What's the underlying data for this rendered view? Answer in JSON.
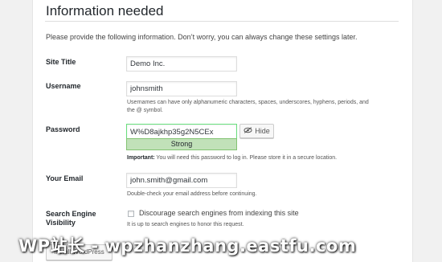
{
  "section": {
    "title": "Information needed",
    "intro": "Please provide the following information. Don’t worry, you can always change these settings later."
  },
  "site_title": {
    "label": "Site Title",
    "value": "Demo Inc."
  },
  "username": {
    "label": "Username",
    "value": "johnsmith",
    "hint_line1": "Usernames can have only alphanumeric characters, spaces, underscores, hyphens, periods, and",
    "hint_line2": "the @ symbol."
  },
  "password": {
    "label": "Password",
    "value": "W%D8ajkhp35g2N5CEx",
    "strength": "Strong",
    "hide_label": "Hide",
    "hide_icon": "eye-slash-icon",
    "important_prefix": "Important:",
    "important_text": " You will need this password to log in. Please store it in a secure location."
  },
  "email": {
    "label": "Your Email",
    "value": "john.smith@gmail.com",
    "hint": "Double-check your email address before continuing."
  },
  "search_engine": {
    "label_line1": "Search Engine",
    "label_line2": "Visibility",
    "checkbox_label": "Discourage search engines from indexing this site",
    "checked": false,
    "hint": "It is up to search engines to honor this request."
  },
  "install_button": "Install WordPress",
  "watermark": "WP站长 - wpzhanzhang.eastfu.com",
  "colors": {
    "background": "#f1f1f1",
    "card": "#ffffff",
    "strength_bg": "#c1e1b9",
    "strength_border": "#83c373"
  }
}
